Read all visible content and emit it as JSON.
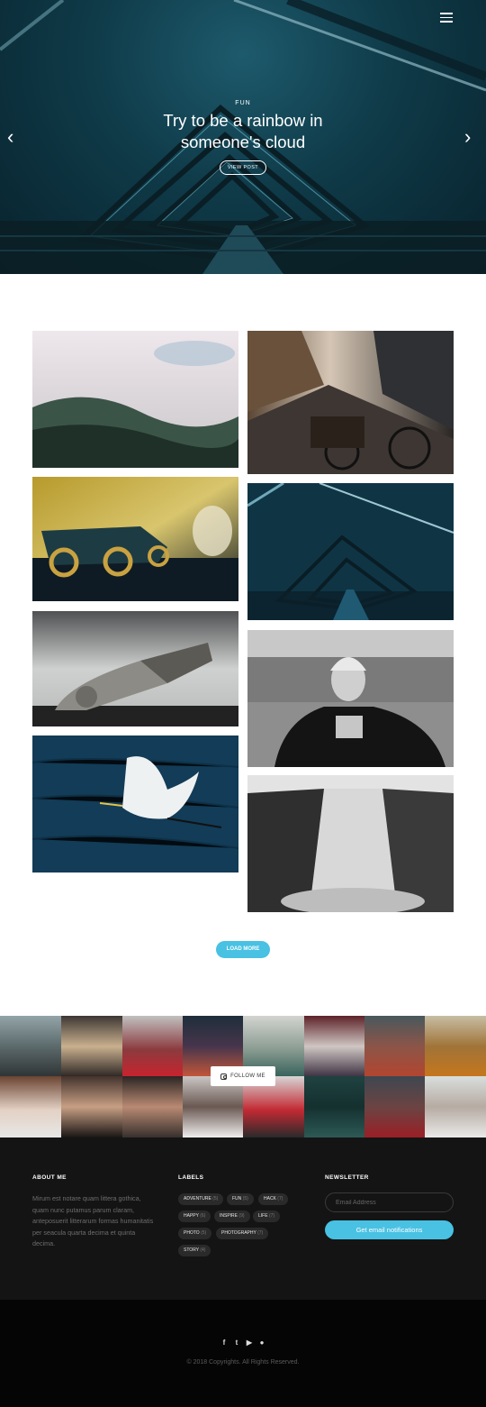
{
  "hero": {
    "category": "FUN",
    "title": "Try to be a rainbow in someone's cloud",
    "button": "VIEW POST"
  },
  "icons": {
    "menu": "hamburger-icon",
    "prev": "chevron-left-icon",
    "next": "chevron-right-icon",
    "follow": "instagram-icon",
    "social": [
      "facebook-icon",
      "twitter-icon",
      "youtube-icon",
      "github-icon"
    ]
  },
  "gallery": {
    "load_more": "LOAD MORE"
  },
  "instagram": {
    "follow_label": "FOLLOW ME"
  },
  "footer": {
    "about_title": "ABOUT ME",
    "about_text": "Mirum est notare quam littera gothica, quam nunc putamus parum claram, anteposuerit litterarum formas humanitatis per seacula quarta decima et quinta decima.",
    "labels_title": "LABELS",
    "labels": [
      {
        "name": "ADVENTURE",
        "count": "(5)"
      },
      {
        "name": "FUN",
        "count": "(5)"
      },
      {
        "name": "HACK",
        "count": "(7)"
      },
      {
        "name": "HAPPY",
        "count": "(6)"
      },
      {
        "name": "INSPIRE",
        "count": "(9)"
      },
      {
        "name": "LIFE",
        "count": "(7)"
      },
      {
        "name": "PHOTO",
        "count": "(5)"
      },
      {
        "name": "PHOTOGRAPHY",
        "count": "(7)"
      },
      {
        "name": "STORY",
        "count": "(4)"
      }
    ],
    "newsletter_title": "NEWSLETTER",
    "email_placeholder": "Email Address",
    "notify_button": "Get email notifications",
    "copyright": "© 2018 Copyrights. All Rights Reserved."
  },
  "colors": {
    "accent": "#48c1e3",
    "footer_bg": "#141414",
    "bottom_bg": "#050505"
  }
}
